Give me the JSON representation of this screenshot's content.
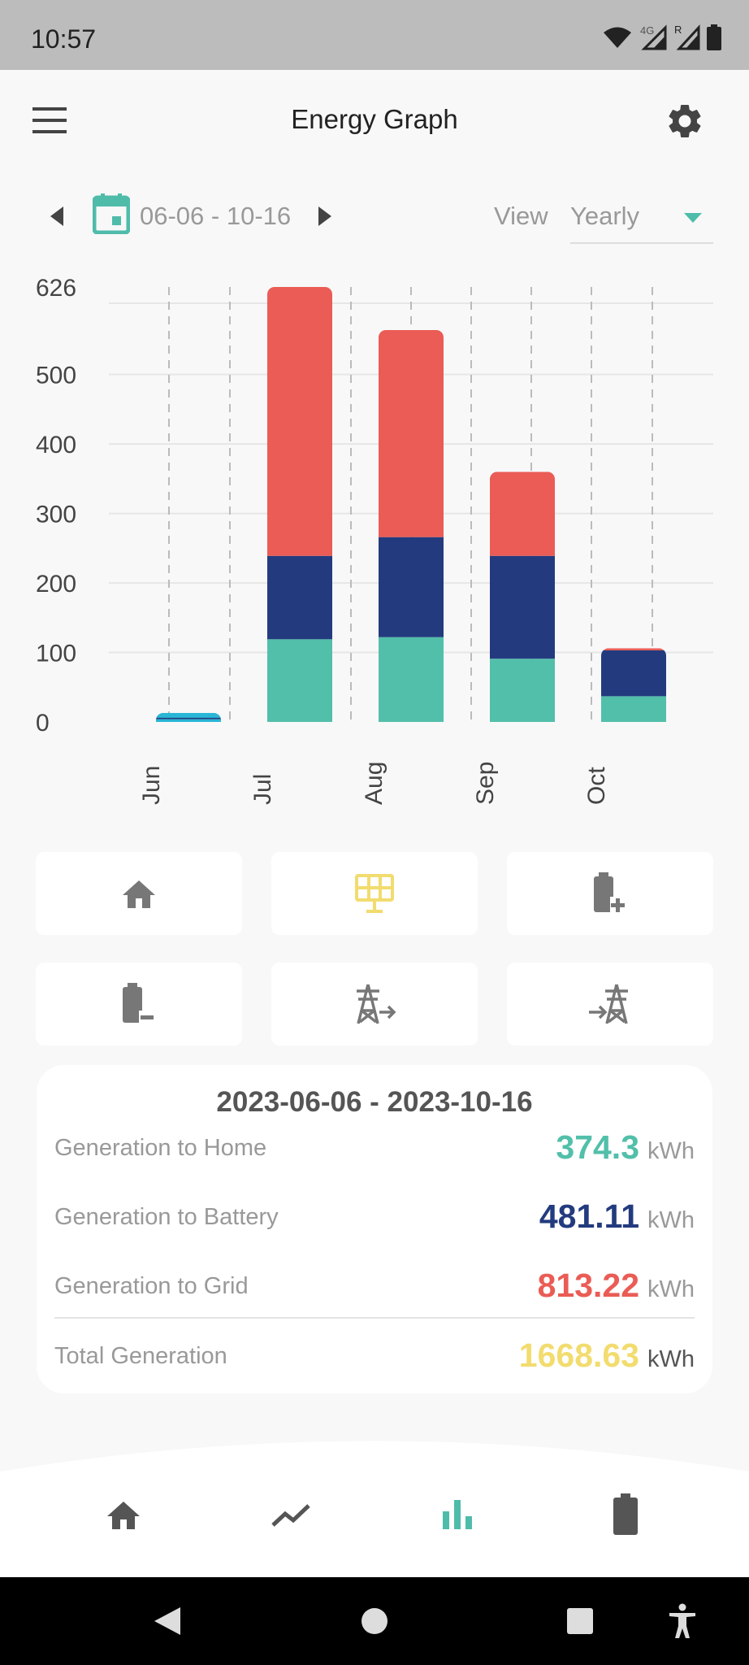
{
  "status_bar": {
    "time": "10:57",
    "network": "4G",
    "roaming": "R"
  },
  "app_bar": {
    "title": "Energy Graph",
    "menu_icon": "hamburger-menu-icon",
    "settings_icon": "gear-icon"
  },
  "date_selector": {
    "range": "06-06 - 10-16",
    "view_label": "View",
    "view_value": "Yearly"
  },
  "colors": {
    "home": "#52bfaa",
    "battery": "#233b7e",
    "grid": "#ea5c55",
    "total": "#f2dc6f",
    "active_tile": "#f2dc6f",
    "accent": "#4fbcaa",
    "june_bar": "#29b6d6"
  },
  "chart_data": {
    "type": "bar",
    "stacked": true,
    "categories": [
      "Jun",
      "Jul",
      "Aug",
      "Sep",
      "Oct"
    ],
    "series": [
      {
        "key": "home",
        "values": [
          4,
          119,
          122,
          91,
          37
        ]
      },
      {
        "key": "battery",
        "values": [
          4,
          120,
          144,
          148,
          66
        ]
      },
      {
        "key": "grid",
        "values": [
          5,
          387,
          298,
          121,
          3
        ]
      }
    ],
    "y_ticks": [
      "0",
      "100",
      "200",
      "300",
      "400",
      "500",
      "626"
    ],
    "ylim": [
      0,
      626
    ],
    "grid": true
  },
  "tiles": [
    {
      "icon": "home-icon"
    },
    {
      "icon": "solar-panel-icon",
      "active": true
    },
    {
      "icon": "battery-charge-icon"
    },
    {
      "icon": "battery-discharge-icon"
    },
    {
      "icon": "grid-export-icon"
    },
    {
      "icon": "grid-import-icon"
    }
  ],
  "summary": {
    "range": "2023-06-06 - 2023-10-16",
    "rows": [
      {
        "label": "Generation to Home",
        "value": "374.3",
        "unit": "kWh"
      },
      {
        "label": "Generation to Battery",
        "value": "481.11",
        "unit": "kWh"
      },
      {
        "label": "Generation to Grid",
        "value": "813.22",
        "unit": "kWh"
      },
      {
        "label": "Total Generation",
        "value": "1668.63",
        "unit": "kWh"
      }
    ]
  },
  "bottom_nav": [
    {
      "icon": "home-icon"
    },
    {
      "icon": "trend-line-icon"
    },
    {
      "icon": "bar-chart-icon",
      "active": true
    },
    {
      "icon": "battery-icon"
    }
  ]
}
